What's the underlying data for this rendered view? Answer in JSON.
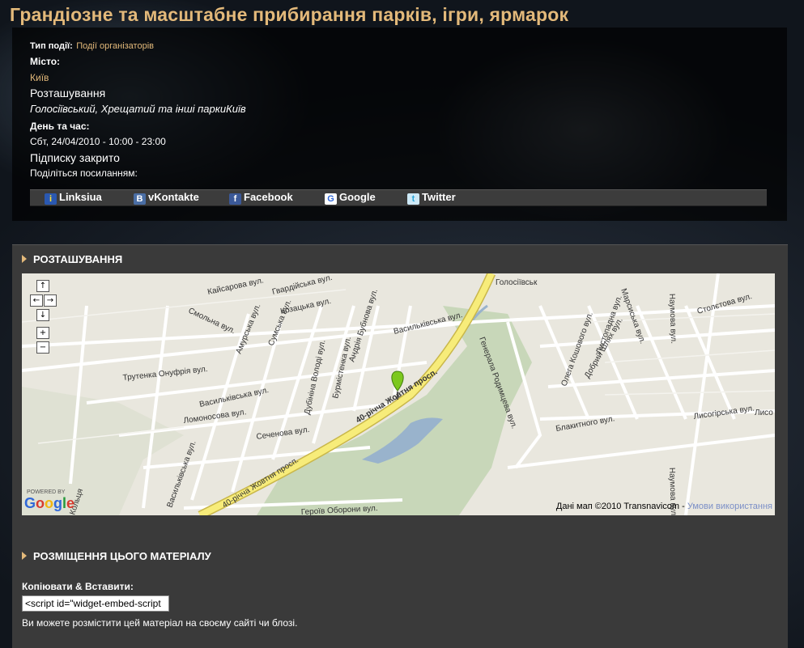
{
  "page_title": "Грандіозне та масштабне прибирання парків, ігри, ярмарок",
  "event": {
    "type_label": "Тип події:",
    "type_value": "Події організаторів",
    "city_label": "Місто:",
    "city_value": "Київ",
    "location_label": "Розташування",
    "location_value": "Голосіївський, Хрещатий та інші паркиКиїв",
    "datetime_label": "День та час:",
    "datetime_value": "Сбт, 24/04/2010 - 10:00 - 23:00",
    "subscription": "Підписку закрито",
    "share_label": "Поділіться посиланням:"
  },
  "share": {
    "items": [
      {
        "label": "Linksiua",
        "icon": "linksiua-icon"
      },
      {
        "label": "vKontakte",
        "icon": "vkontakte-icon"
      },
      {
        "label": "Facebook",
        "icon": "facebook-icon"
      },
      {
        "label": "Google",
        "icon": "google-icon"
      },
      {
        "label": "Twitter",
        "icon": "twitter-icon"
      }
    ]
  },
  "location_section": {
    "heading": "РОЗТАШУВАННЯ",
    "map": {
      "credit": "Дані мап ©2010 Transnavicom - ",
      "terms": "Умови використання",
      "logo": "Google",
      "powered": "POWERED BY",
      "streets": [
        "Кайсарова вул.",
        "Гвардійська вул.",
        "Смольна вул.",
        "Козацька вул.",
        "Сумська вул.",
        "Амурська вул.",
        "Васильківська вул.",
        "Андрія Бубнова вул.",
        "Трутенка Онуфрія вул.",
        "Бурмістенка вул.",
        "Дубініна Володі вул.",
        "40-річча Жовтня просп.",
        "Ломоносова вул.",
        "Сеченова вул.",
        "Героїв Оборони вул.",
        "Голосіївська",
        "Генерала Родимцева вул.",
        "Блакитного вул.",
        "Лисогірська вул.",
        "Наумова вул.",
        "Столєтова вул.",
        "Марсиська вул.",
        "Олега Кошового вул.",
        "Листопадна вул.",
        "Добрий Шлях вул.",
        "Лисогірська"
      ]
    }
  },
  "embed_section": {
    "heading": "РОЗМІЩЕННЯ ЦЬОГО МАТЕРІАЛУ",
    "copy_label": "Копіювати & Вставити:",
    "embed_value": "<script id=\"widget-embed-script",
    "hint": "Ви можете розмістити цей матеріал на своєму сайті чи блозі."
  },
  "colors": {
    "accent": "#e3b97a",
    "panel": "#3a3a3a",
    "marker": "#7cc81e",
    "road_major": "#f7ec7a"
  }
}
